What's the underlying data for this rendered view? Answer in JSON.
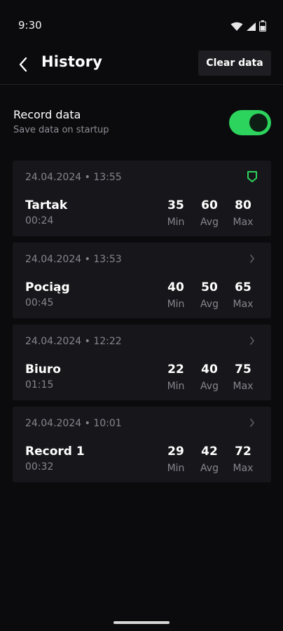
{
  "status_bar": {
    "time": "9:30",
    "icons": [
      "wifi-icon",
      "signal-icon",
      "battery-icon"
    ]
  },
  "header": {
    "title": "History",
    "back_icon": "chevron-left-icon",
    "clear_label": "Clear data"
  },
  "record": {
    "title": "Record data",
    "subtitle": "Save data on startup",
    "enabled": true
  },
  "stat_labels": {
    "min": "Min",
    "avg": "Avg",
    "max": "Max"
  },
  "history": [
    {
      "date": "24.04.2024 • 13:55",
      "name": "Tartak",
      "duration": "00:24",
      "min": "35",
      "avg": "60",
      "max": "80",
      "icon": "shield-icon"
    },
    {
      "date": "24.04.2024 • 13:53",
      "name": "Pociąg",
      "duration": "00:45",
      "min": "40",
      "avg": "50",
      "max": "65",
      "icon": "chevron-right-icon"
    },
    {
      "date": "24.04.2024 • 12:22",
      "name": "Biuro",
      "duration": "01:15",
      "min": "22",
      "avg": "40",
      "max": "75",
      "icon": "chevron-right-icon"
    },
    {
      "date": "24.04.2024 • 10:01",
      "name": "Record 1",
      "duration": "00:32",
      "min": "29",
      "avg": "42",
      "max": "72",
      "icon": "chevron-right-icon"
    }
  ],
  "colors": {
    "accent": "#2cd35c",
    "background": "#0b0b0e",
    "card": "#17171b",
    "muted_text": "#85858c"
  }
}
